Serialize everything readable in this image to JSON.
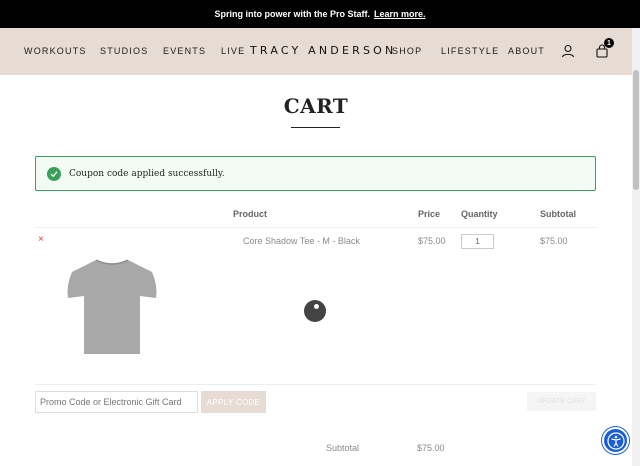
{
  "announcement": {
    "text": "Spring into power with the Pro Staff.",
    "link": "Learn more."
  },
  "nav": {
    "left": [
      "WORKOUTS",
      "STUDIOS",
      "EVENTS",
      "LIVE"
    ],
    "logo": "TRACY ANDERSON",
    "right": [
      "SHOP",
      "LIFESTYLE",
      "ABOUT"
    ],
    "cart_count": "1"
  },
  "page": {
    "title": "CART"
  },
  "notice": {
    "message": "Coupon code applied successfully."
  },
  "table": {
    "headers": {
      "product": "Product",
      "price": "Price",
      "quantity": "Quantity",
      "subtotal": "Subtotal"
    },
    "items": [
      {
        "remove": "×",
        "name": "Core Shadow Tee - M - Black",
        "price": "$75.00",
        "quantity": "1",
        "subtotal": "$75.00"
      }
    ]
  },
  "coupon": {
    "placeholder": "Promo Code or Electronic Gift Card",
    "apply_label": "APPLY CODE",
    "update_label": "UPDATE CART"
  },
  "totals": {
    "subtotal_label": "Subtotal",
    "subtotal_value": "$75.00"
  },
  "colors": {
    "header_bg": "#e7dcd4",
    "success": "#3aa15a",
    "remove": "#e2401c",
    "accessibility": "#1a5fd1"
  },
  "icons": {
    "account": "user-icon",
    "cart": "shopping-bag-icon",
    "notice": "check-circle-icon",
    "accessibility": "accessibility-icon"
  }
}
